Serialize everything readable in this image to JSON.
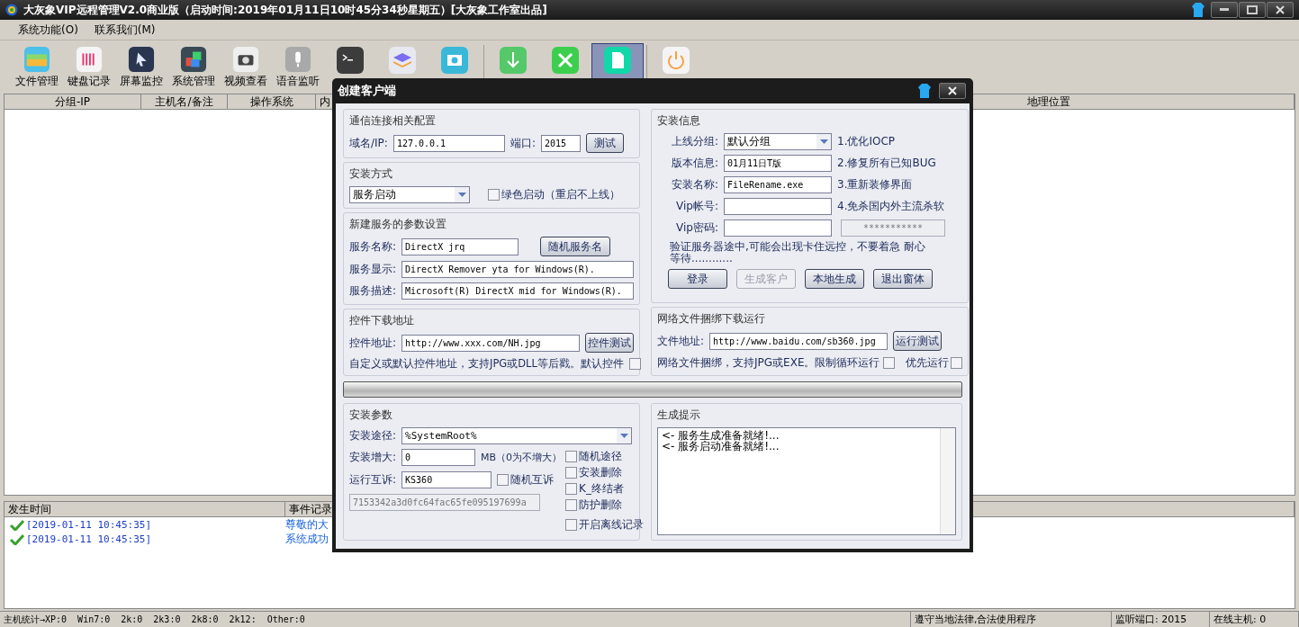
{
  "window": {
    "title": "大灰象VIP远程管理V2.0商业版（启动时间:2019年01月11日10时45分34秒星期五）[大灰象工作室出品]"
  },
  "menu": [
    "系统功能(O)",
    "联系我们(M)"
  ],
  "toolbar": [
    {
      "kind": "files",
      "label": "文件管理",
      "selected": false
    },
    {
      "kind": "keyboard",
      "label": "键盘记录",
      "selected": false
    },
    {
      "kind": "screen",
      "label": "屏幕监控",
      "selected": false
    },
    {
      "kind": "system",
      "label": "系统管理",
      "selected": false
    },
    {
      "kind": "camera",
      "label": "视频查看",
      "selected": false
    },
    {
      "kind": "mic",
      "label": "语音监听",
      "selected": false
    },
    {
      "kind": "terminal",
      "selected": false
    },
    {
      "kind": "layers",
      "selected": false
    },
    {
      "kind": "photo",
      "selected": false
    },
    {
      "kind": "download",
      "selected": false
    },
    {
      "kind": "tools",
      "selected": false
    },
    {
      "kind": "document",
      "selected": true
    },
    {
      "kind": "power",
      "selected": false
    }
  ],
  "host_table": {
    "columns": [
      "分组-IP",
      "主机名/备注",
      "操作系统",
      "内",
      "地理位置"
    ]
  },
  "event_log": {
    "columns": [
      "发生时间",
      "事件记录"
    ],
    "rows": [
      {
        "time": "[2019-01-11 10:45:35]",
        "event": "尊敬的大"
      },
      {
        "time": "[2019-01-11 10:45:35]",
        "event": "系统成功"
      }
    ]
  },
  "status_bar": {
    "stats": [
      "主机统计→XP:0",
      "Win7:0",
      "2k:0",
      "2k3:0",
      "2k8:0",
      "2k12:",
      "Other:0"
    ],
    "notice": "遵守当地法律,合法使用程序",
    "port": "监听端口: 2015",
    "online": "在线主机: 0"
  },
  "dialog": {
    "title": "创建客户端",
    "connection": {
      "title": "通信连接相关配置",
      "host_label": "域名/IP:",
      "host": "127.0.0.1",
      "port_label": "端口:",
      "port": "2015",
      "test_button": "测试"
    },
    "install_mode": {
      "title": "安装方式",
      "mode": "服务启动",
      "green": {
        "label": "绿色启动（重启不上线）",
        "checked": false
      }
    },
    "service": {
      "title": "新建服务的参数设置",
      "random_button": "随机服务名",
      "fields": [
        {
          "label": "服务名称:",
          "value": "DirectX jrq"
        },
        {
          "label": "服务显示:",
          "value": "DirectX Remover yta for Windows(R)."
        },
        {
          "label": "服务描述:",
          "value": "Microsoft(R) DirectX mid for Windows(R)."
        }
      ]
    },
    "plugin": {
      "title": "控件下载地址",
      "label": "控件地址:",
      "url": "http://www.xxx.com/NH.jpg",
      "test_button": "控件测试",
      "note": "自定义或默认控件地址，支持JPG或DLL等后戳。默认控件",
      "checked": false
    },
    "install_info": {
      "title": "安装信息",
      "rows": [
        {
          "kind": "combo",
          "label": "上线分组:",
          "value": "默认分组",
          "feature": "1.优化IOCP"
        },
        {
          "kind": "text",
          "label": "版本信息:",
          "value": "01月11日T版",
          "feature": "2.修复所有已知BUG"
        },
        {
          "kind": "text",
          "label": "安装名称:",
          "value": "FileRename.exe",
          "feature": "3.重新装修界面"
        },
        {
          "kind": "text",
          "label": "Vip帐号:",
          "feature": "4.免杀国内外主流杀软"
        },
        {
          "kind": "text",
          "label": "Vip密码:",
          "masked": "***********"
        }
      ],
      "note": "验证服务器途中,可能会出现卡住远控，不要着急 耐心等待............",
      "buttons": [
        {
          "label": "登录",
          "disabled": false
        },
        {
          "label": "生成客户",
          "disabled": true
        },
        {
          "label": "本地生成",
          "disabled": false
        },
        {
          "label": "退出窗体",
          "disabled": false
        }
      ]
    },
    "bundle": {
      "title": "网络文件捆绑下载运行",
      "label": "文件地址:",
      "url": "http://www.baidu.com/sb360.jpg",
      "test_button": "运行测试",
      "note": "网络文件捆绑，支持JPG或EXE。限制循环运行",
      "loop_checked": false,
      "priority": {
        "label": "优先运行",
        "checked": false
      }
    },
    "progress": {
      "level": 0
    },
    "install_params": {
      "title": "安装参数",
      "path_label": "安装途径:",
      "path": "%SystemRoot%",
      "grow_label": "安装增大:",
      "grow": "0",
      "grow_unit": "MB（0为不增大）",
      "mutex_label": "运行互诉:",
      "mutex": "KS360",
      "random_mutex": {
        "label": "随机互诉",
        "checked": false
      },
      "hash": "7153342a3d0fc64fac65fe095197699a",
      "options": [
        {
          "label": "随机途径",
          "checked": false
        },
        {
          "label": "安装删除",
          "checked": false
        },
        {
          "label": "K_终结者",
          "checked": false
        },
        {
          "label": "防护删除",
          "checked": false
        }
      ],
      "offline": {
        "label": "开启离线记录",
        "checked": false
      }
    },
    "output": {
      "title": "生成提示",
      "lines": [
        "<- 服务生成准备就绪!...",
        "<- 服务启动准备就绪!..."
      ]
    }
  }
}
